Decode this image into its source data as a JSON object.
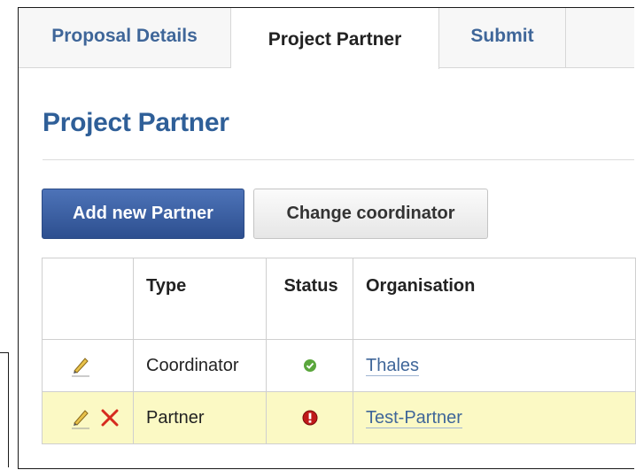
{
  "tabs": [
    {
      "label": "Proposal Details",
      "active": false
    },
    {
      "label": "Project Partner",
      "active": true
    },
    {
      "label": "Submit",
      "active": false
    }
  ],
  "page": {
    "title": "Project Partner"
  },
  "toolbar": {
    "add_label": "Add new Partner",
    "change_label": "Change coordinator"
  },
  "table": {
    "headers": {
      "actions": "",
      "type": "Type",
      "status": "Status",
      "organisation": "Organisation"
    },
    "rows": [
      {
        "type": "Coordinator",
        "status": "ok",
        "organisation": "Thales",
        "icons": [
          "pencil-icon"
        ]
      },
      {
        "type": "Partner",
        "status": "warning",
        "organisation": "Test-Partner",
        "icons": [
          "pencil-icon",
          "delete-x-icon"
        ]
      }
    ]
  },
  "colors": {
    "accent": "#3f6699",
    "title": "#2f5f98",
    "primary_button": "#3d62a8",
    "highlight_row": "#fbf9c4",
    "status_ok": "#5aa63c",
    "status_warning": "#c01919",
    "delete_icon": "#d62b1f"
  }
}
